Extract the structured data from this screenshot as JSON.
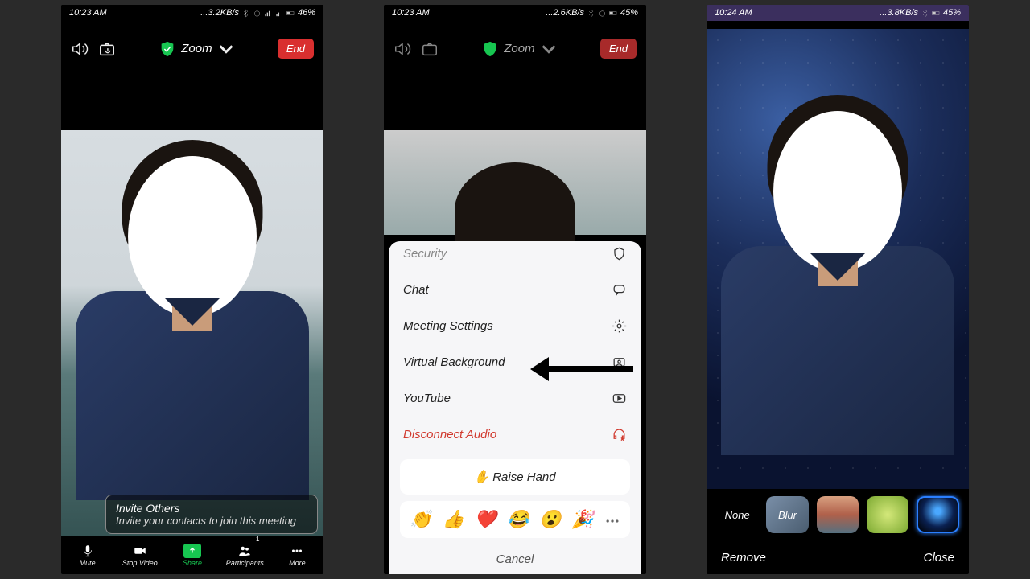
{
  "s1": {
    "status": {
      "time": "10:23 AM",
      "net": "...3.2KB/s",
      "batt": "46%"
    },
    "zoom": "Zoom",
    "end": "End",
    "invite": {
      "title": "Invite Others",
      "sub": "Invite your contacts to join this meeting"
    },
    "bar": {
      "mute": "Mute",
      "stop": "Stop Video",
      "share": "Share",
      "part": "Participants",
      "part_count": "1",
      "more": "More"
    }
  },
  "s2": {
    "status": {
      "time": "10:23 AM",
      "net": "...2.6KB/s",
      "batt": "45%"
    },
    "zoom": "Zoom",
    "end": "End",
    "menu": {
      "security": "Security",
      "chat": "Chat",
      "settings": "Meeting Settings",
      "vbg": "Virtual Background",
      "youtube": "YouTube",
      "disconnect": "Disconnect Audio"
    },
    "raise": "✋ Raise Hand",
    "emojis": [
      "👏",
      "👍",
      "❤️",
      "😂",
      "😮",
      "🎉"
    ],
    "cancel": "Cancel"
  },
  "s3": {
    "status": {
      "time": "10:24 AM",
      "net": "...3.8KB/s",
      "batt": "45%"
    },
    "opts": {
      "none": "None",
      "blur": "Blur"
    },
    "remove": "Remove",
    "close": "Close"
  }
}
